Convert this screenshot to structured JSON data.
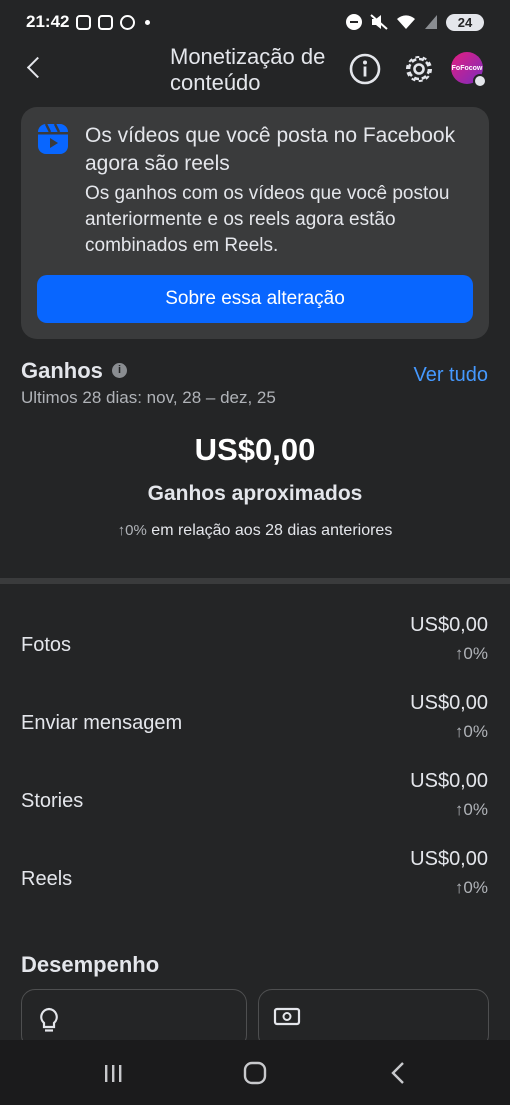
{
  "status_bar": {
    "time": "21:42",
    "battery": "24",
    "left_icons": [
      "instagram-icon",
      "screenshot-icon",
      "whatsapp-icon",
      "notification-dot"
    ],
    "right_icons": [
      "dnd-icon",
      "mute-icon",
      "wifi-icon",
      "signal-icon"
    ]
  },
  "header": {
    "title": "Monetização de conteúdo",
    "avatar_text": "FoFocow"
  },
  "notice": {
    "title": "Os vídeos que você posta no Facebook agora são reels",
    "body": "Os ganhos com os vídeos que você postou anteriormente e os reels agora estão combinados em Reels.",
    "button": "Sobre essa alteração"
  },
  "earnings": {
    "title": "Ganhos",
    "see_all": "Ver tudo",
    "period_label": "Ultimos 28 dias:",
    "period_range": "nov, 28 – dez, 25",
    "total": "US$0,00",
    "total_label": "Ganhos aproximados",
    "change_pct": "↑0%",
    "change_text": "em relação aos 28 dias anteriores",
    "rows": [
      {
        "label": "Fotos",
        "value": "US$0,00",
        "change": "↑0%"
      },
      {
        "label": "Enviar mensagem",
        "value": "US$0,00",
        "change": "↑0%"
      },
      {
        "label": "Stories",
        "value": "US$0,00",
        "change": "↑0%"
      },
      {
        "label": "Reels",
        "value": "US$0,00",
        "change": "↑0%"
      }
    ]
  },
  "performance": {
    "title": "Desempenho",
    "cards": [
      "lightbulb-icon",
      "money-icon"
    ]
  },
  "colors": {
    "background": "#242526",
    "card": "#3a3b3c",
    "accent": "#0866ff",
    "link": "#4599ff"
  }
}
